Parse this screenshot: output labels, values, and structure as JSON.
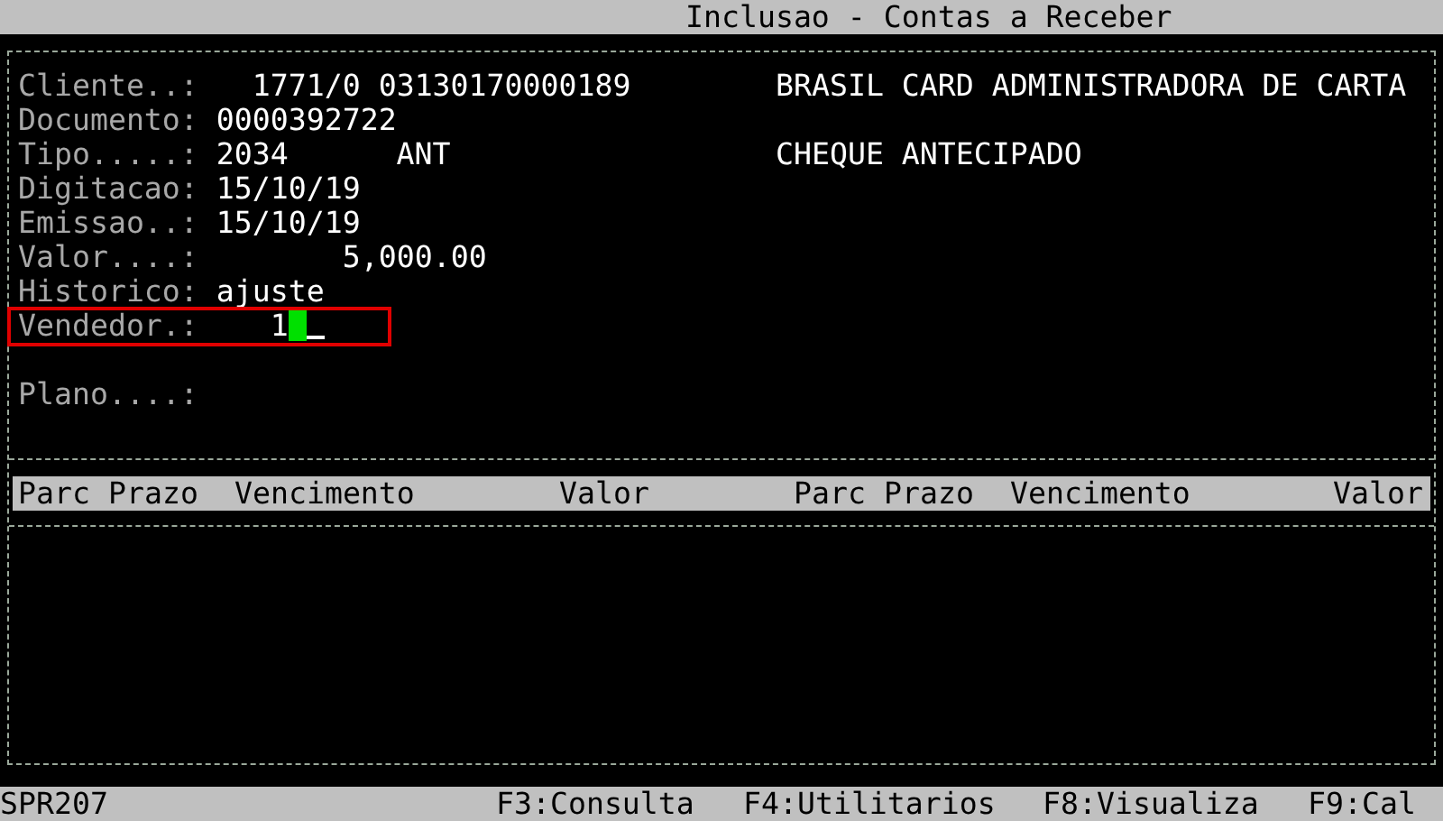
{
  "window": {
    "title": "Inclusao - Contas a Receber"
  },
  "fields": [
    {
      "label": "Cliente..:",
      "value": "1771/0 03130170000189",
      "extra": "BRASIL CARD ADMINISTRADORA DE CARTA",
      "focused": false
    },
    {
      "label": "Documento:",
      "value": "0000392722",
      "focused": false
    },
    {
      "label": "Tipo.....:",
      "value": "2034      ANT",
      "extra": "CHEQUE ANTECIPADO",
      "focused": false
    },
    {
      "label": "Digitacao:",
      "value": "15/10/19",
      "focused": false
    },
    {
      "label": "Emissao..:",
      "value": "15/10/19",
      "focused": false
    },
    {
      "label": "Valor....:",
      "value": "5,000.00",
      "focused": false
    },
    {
      "label": "Historico:",
      "value": "ajuste",
      "focused": false
    },
    {
      "label": "Vendedor.:",
      "value": "1",
      "focused": true
    },
    {
      "label": "Plano....:",
      "focused": false
    }
  ],
  "table": {
    "columns": [
      "Parc",
      "Prazo",
      "Vencimento",
      "Valor",
      "Parc",
      "Prazo",
      "Vencimento",
      "Valor"
    ]
  },
  "status_bar": {
    "program": "SPR207",
    "keys": [
      "F3:Consulta",
      "F4:Utilitarios",
      "F8:Visualiza",
      "F9:Cal"
    ]
  }
}
